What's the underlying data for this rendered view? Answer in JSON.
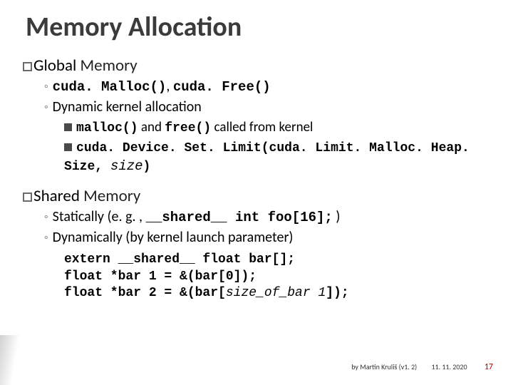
{
  "title": "Memory Allocation",
  "section_global": {
    "head_box": "Global",
    "head_rest": " Memory",
    "b1_pre": "cuda. Malloc()",
    "b1_mid": ", ",
    "b1_post": "cuda. Free()",
    "b2": "Dynamic kernel allocation",
    "bb1_code1": "malloc()",
    "bb1_mid": " and ",
    "bb1_code2": "free()",
    "bb1_tail": " called from kernel",
    "bb2_code": "cuda. Device. Set. Limit(cuda. Limit. Malloc. Heap. Size, ",
    "bb2_arg": "size",
    "bb2_close": ")"
  },
  "section_shared": {
    "head_box": "Shared",
    "head_rest": " Memory",
    "b1_pre": "Statically (e. g. , ",
    "b1_code": "__shared__ int foo[16];",
    "b1_post": " )",
    "b2": "Dynamically (by kernel launch parameter)",
    "code1": "extern __shared__ float bar[];",
    "code2_a": "float *bar 1 = &(bar[0]);",
    "code3_a": "float *bar 2 = &(bar[",
    "code3_i": "size_of_bar 1",
    "code3_b": "]);"
  },
  "footer": {
    "by": "by Martin Kruliš (v1. 2)",
    "date": "11. 11. 2020",
    "page": "17"
  }
}
